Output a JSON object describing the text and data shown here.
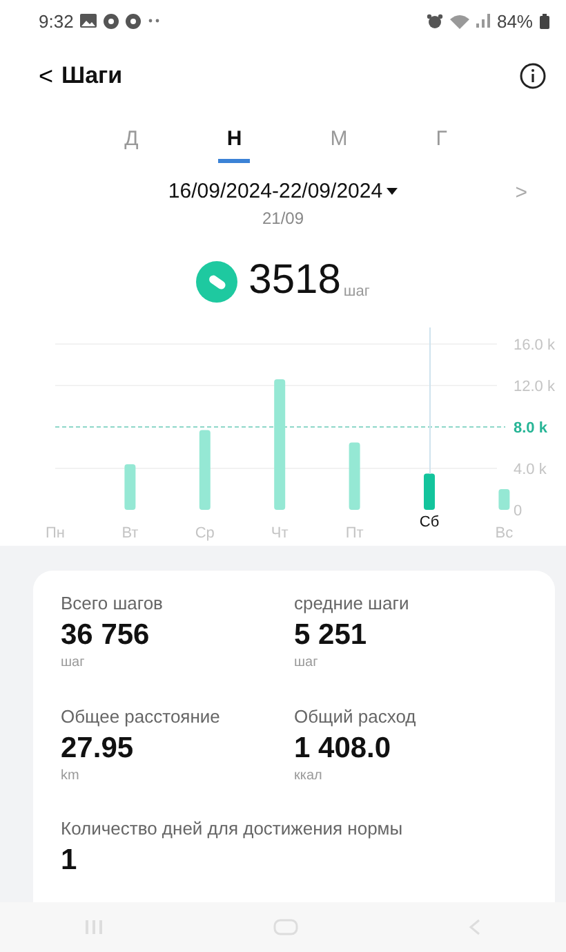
{
  "status_bar": {
    "time": "9:32",
    "battery": "84%"
  },
  "header": {
    "back": "<",
    "title": "Шаги"
  },
  "tabs": [
    {
      "label": "Д",
      "selected": false
    },
    {
      "label": "Н",
      "selected": true
    },
    {
      "label": "М",
      "selected": false
    },
    {
      "label": "Г",
      "selected": false
    }
  ],
  "period": {
    "range": "16/09/2024-22/09/2024",
    "selected_day": "21/09",
    "next": ">"
  },
  "today": {
    "value": "3518",
    "unit": "шаг"
  },
  "chart_data": {
    "type": "bar",
    "categories": [
      "Пн",
      "Вт",
      "Ср",
      "Чт",
      "Пт",
      "Сб",
      "Вс"
    ],
    "values": [
      0,
      4400,
      7700,
      12600,
      6500,
      3500,
      2000
    ],
    "ylim": [
      0,
      16000
    ],
    "yticks": [
      {
        "value": 0,
        "label": "0"
      },
      {
        "value": 4000,
        "label": "4.0 k"
      },
      {
        "value": 8000,
        "label": "8.0 k"
      },
      {
        "value": 12000,
        "label": "12.0 k"
      },
      {
        "value": 16000,
        "label": "16.0 k"
      }
    ],
    "ref_lines": [
      {
        "axis": "y",
        "value": 8000
      },
      {
        "axis": "x",
        "value": "Сб"
      }
    ]
  },
  "stats": [
    {
      "label": "Всего шагов",
      "value": "36 756",
      "unit": "шаг"
    },
    {
      "label": "средние шаги",
      "value": "5 251",
      "unit": "шаг"
    },
    {
      "label": "Общее расстояние",
      "value": "27.95",
      "unit": "km"
    },
    {
      "label": "Общий расход",
      "value": "1 408.0",
      "unit": "ккал"
    },
    {
      "label": "Количество дней для достижения нормы",
      "value": "1"
    }
  ]
}
